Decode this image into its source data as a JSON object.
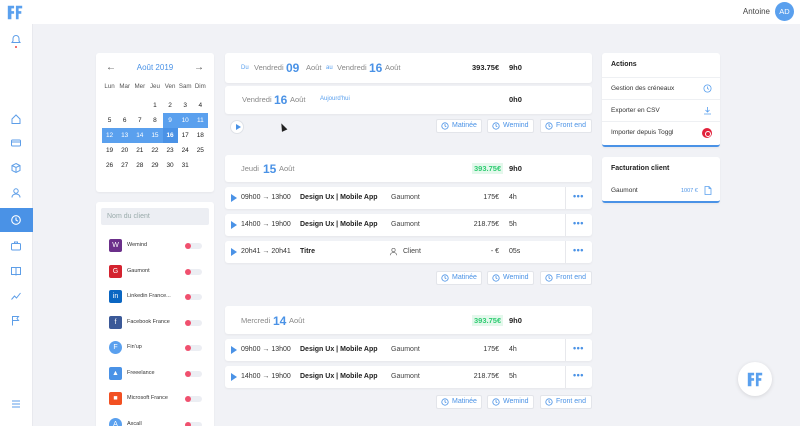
{
  "header": {
    "user_name": "Antoine",
    "avatar_initials": "AD"
  },
  "calendar": {
    "prev": "←",
    "next": "→",
    "month_label": "Août 2019",
    "weekdays": [
      "Lun",
      "Mar",
      "Mer",
      "Jeu",
      "Ven",
      "Sam",
      "Dim"
    ],
    "days": [
      [
        "",
        "",
        "",
        "1",
        "2",
        "3",
        "4"
      ],
      [
        "5",
        "6",
        "7",
        "8",
        "9",
        "10",
        "11"
      ],
      [
        "12",
        "13",
        "14",
        "15",
        "16",
        "17",
        "18"
      ],
      [
        "19",
        "20",
        "21",
        "22",
        "23",
        "24",
        "25"
      ],
      [
        "26",
        "27",
        "28",
        "29",
        "30",
        "31",
        ""
      ]
    ],
    "selected_days": [
      "9",
      "10",
      "11",
      "12",
      "13",
      "14",
      "15",
      "16"
    ],
    "today": "16"
  },
  "clients": {
    "search_placeholder": "Nom du client",
    "items": [
      {
        "name": "Wemind",
        "logo": "W",
        "color": "#6b2f8a"
      },
      {
        "name": "Gaumont",
        "logo": "G",
        "color": "#d4232f"
      },
      {
        "name": "Linkedin France...",
        "logo": "in",
        "color": "#0a66c2"
      },
      {
        "name": "Facebook France",
        "logo": "f",
        "color": "#3b5998"
      },
      {
        "name": "Fin'up",
        "logo": "F",
        "color": "#5aa0ee"
      },
      {
        "name": "Freeelance",
        "logo": "▲",
        "color": "#4a92e6"
      },
      {
        "name": "Microsoft France",
        "logo": "■",
        "color": "#f25022"
      },
      {
        "name": "Axcall",
        "logo": "A",
        "color": "#5aa0ee"
      }
    ]
  },
  "period": {
    "du": "Du",
    "start_weekday": "Vendredi",
    "start_day": "09",
    "start_month": "Août",
    "au": "au",
    "end_weekday": "Vendredi",
    "end_day": "16",
    "end_month": "Août",
    "amount": "393.75€",
    "hours": "9h0"
  },
  "today_card": {
    "weekday": "Vendredi",
    "day": "16",
    "month": "Août",
    "today_label": "Aujourd'hui",
    "hours": "0h0"
  },
  "tags": {
    "matinee": "Matinée",
    "wemind": "Wemind",
    "frontend": "Front end"
  },
  "day1": {
    "weekday": "Jeudi",
    "day": "15",
    "month": "Août",
    "amount": "393.75€",
    "hours": "9h0",
    "entries": [
      {
        "time": "09h00 → 13h00",
        "project": "Design Ux | Mobile App",
        "client": "Gaumont",
        "amount": "175€",
        "hours": "4h"
      },
      {
        "time": "14h00 → 19h00",
        "project": "Design Ux | Mobile App",
        "client": "Gaumont",
        "amount": "218.75€",
        "hours": "5h"
      },
      {
        "time": "20h41 → 20h41",
        "project": "Titre",
        "client": "Client",
        "amount": "- €",
        "hours": "05s"
      }
    ]
  },
  "day2": {
    "weekday": "Mercredi",
    "day": "14",
    "month": "Août",
    "amount": "393.75€",
    "hours": "9h0",
    "entries": [
      {
        "time": "09h00 → 13h00",
        "project": "Design Ux | Mobile App",
        "client": "Gaumont",
        "amount": "175€",
        "hours": "4h"
      },
      {
        "time": "14h00 → 19h00",
        "project": "Design Ux | Mobile App",
        "client": "Gaumont",
        "amount": "218.75€",
        "hours": "5h"
      }
    ]
  },
  "actions": {
    "title": "Actions",
    "items": [
      "Gestion des créneaux",
      "Exporter en CSV",
      "Importer depuis Toggl"
    ]
  },
  "billing": {
    "title": "Facturation client",
    "client": "Gaumont",
    "amount": "1007 €"
  },
  "colors": {
    "accent": "#4a92e6",
    "positive": "#2ecc71",
    "toggle_off": "#f0506e"
  }
}
